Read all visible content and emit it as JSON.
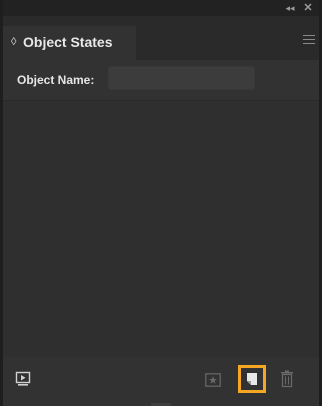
{
  "panel": {
    "topbar": {
      "collapse_icon": "double-chevron-left-icon",
      "close_icon": "close-icon",
      "collapse_glyph": "◂◂",
      "close_glyph": "✕"
    },
    "tab": {
      "icon_glyph": "◊",
      "icon": "sort-arrows-icon",
      "label": "Object States"
    },
    "menu_icon": "hamburger-menu-icon",
    "object_name": {
      "label": "Object Name:",
      "value": "",
      "placeholder": ""
    },
    "footer": {
      "buttons": [
        {
          "name": "preview",
          "icon": "preview-icon"
        },
        {
          "name": "convert-to-state",
          "icon": "star-box-icon",
          "state": "disabled"
        },
        {
          "name": "new-state",
          "icon": "new-page-icon",
          "highlighted": true
        },
        {
          "name": "delete-state",
          "icon": "trash-icon",
          "state": "disabled"
        }
      ]
    },
    "colors": {
      "highlight": "#f5a623",
      "panel_bg": "#323232",
      "text": "#e6e6e6"
    }
  }
}
